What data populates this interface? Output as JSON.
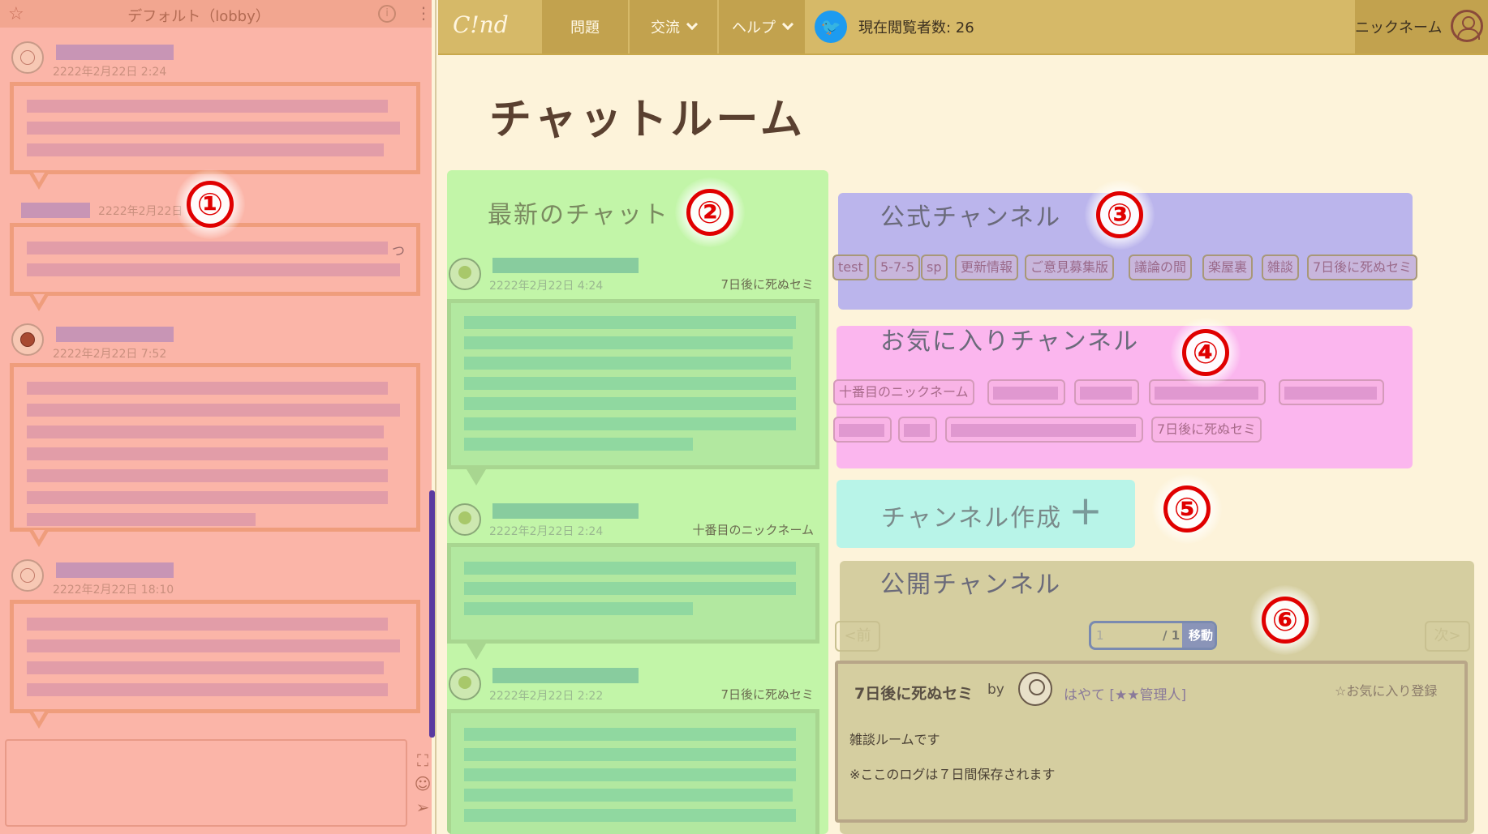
{
  "left_panel": {
    "title": "デフォルト（lobby）",
    "info_icon": "i",
    "messages": [
      {
        "date": "2222年2月22日 2:24"
      },
      {
        "date": "2222年2月22日"
      },
      {
        "date": "2222年2月22日 7:52"
      },
      {
        "date": "2222年2月22日 18:10"
      }
    ],
    "trailing_char": "つ"
  },
  "topbar": {
    "logo": "C!nd",
    "nav": [
      {
        "label": "問題"
      },
      {
        "label": "交流"
      },
      {
        "label": "ヘルプ"
      }
    ],
    "viewer_count": "現在閲覧者数: 26",
    "nickname": "ニックネーム"
  },
  "page_title": "チャットルーム",
  "latest": {
    "title": "最新のチャット",
    "items": [
      {
        "date": "2222年2月22日 4:24",
        "channel": "7日後に死ぬセミ"
      },
      {
        "date": "2222年2月22日 2:24",
        "channel": "十番目のニックネーム"
      },
      {
        "date": "2222年2月22日 2:22",
        "channel": "7日後に死ぬセミ"
      }
    ]
  },
  "official": {
    "title": "公式チャンネル",
    "channels": [
      "test",
      "5-7-5",
      "sp",
      "更新情報",
      "ご意見募集版",
      "議論の間",
      "楽屋裏",
      "雑談",
      "7日後に死ぬセミ"
    ]
  },
  "favorite": {
    "title": "お気に入りチャンネル",
    "channels": [
      "十番目のニックネーム",
      "7日後に死ぬセミ"
    ]
  },
  "create": {
    "label": "チャンネル作成",
    "plus": "+"
  },
  "public": {
    "title": "公開チャンネル",
    "prev": "<前",
    "next": "次>",
    "page_value": "1",
    "page_total": "/ 1",
    "go": "移動",
    "card": {
      "name": "7日後に死ぬセミ",
      "by": "by",
      "author": "はやて [★★管理人]",
      "fav": "☆お気に入り登録",
      "desc1": "雑談ルームです",
      "desc2": "※ここのログは７日間保存されます"
    }
  },
  "markers": [
    "①",
    "②",
    "③",
    "④",
    "⑤",
    "⑥"
  ],
  "colors": {
    "accent": "#d6b968",
    "panel1": "#fbb5a8",
    "panel2": "#c2f5a8",
    "panel3": "#bbb5ec",
    "panel4": "#fbb6ee",
    "panel5": "#b8f4e8",
    "panel6": "#d5cea0",
    "marker": "#e00000"
  },
  "icons": [
    "star-icon",
    "info-icon",
    "kebab-icon",
    "expand-icon",
    "emoji-icon",
    "send-icon",
    "twitter-icon",
    "user-icon",
    "plus-icon",
    "chevron-down-icon"
  ]
}
